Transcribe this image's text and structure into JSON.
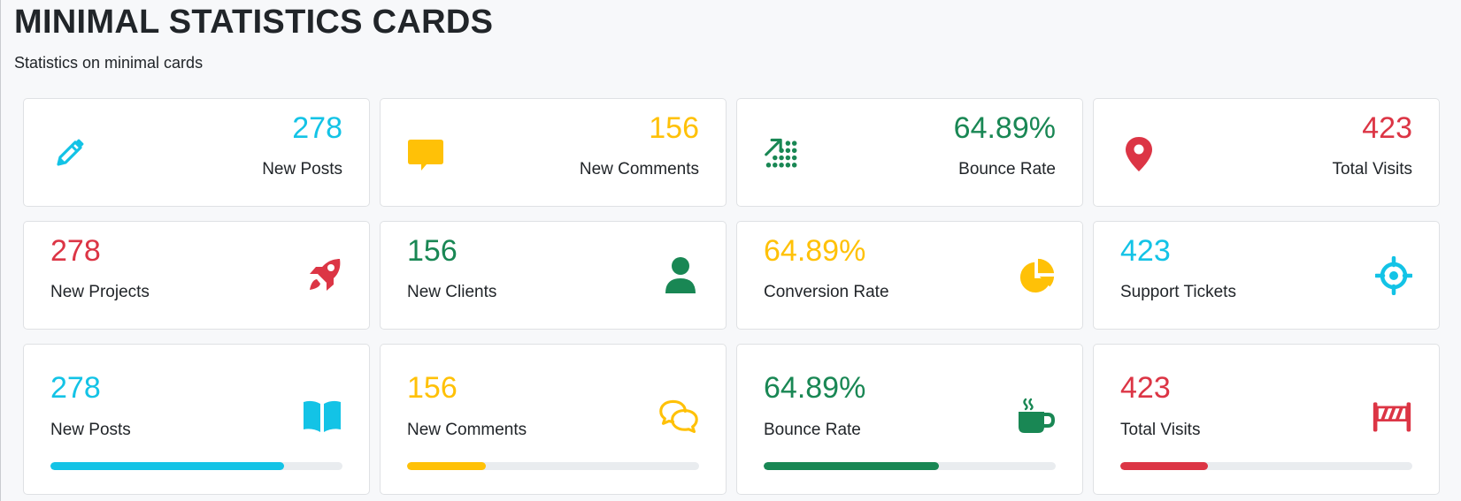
{
  "header": {
    "title": "MINIMAL STATISTICS CARDS",
    "subtitle": "Statistics on minimal cards"
  },
  "colors": {
    "info": "#13c3e6",
    "warning": "#ffc107",
    "success": "#198754",
    "danger": "#dc3545"
  },
  "row1": [
    {
      "value": "278",
      "label": "New Posts",
      "color": "#13c3e6",
      "icon": "pencil-icon"
    },
    {
      "value": "156",
      "label": "New Comments",
      "color": "#ffc107",
      "icon": "speech-bubble-icon"
    },
    {
      "value": "64.89%",
      "label": "Bounce Rate",
      "color": "#198754",
      "icon": "trend-up-dots-icon"
    },
    {
      "value": "423",
      "label": "Total Visits",
      "color": "#dc3545",
      "icon": "map-pin-icon"
    }
  ],
  "row2": [
    {
      "value": "278",
      "label": "New Projects",
      "color": "#dc3545",
      "icon": "rocket-icon"
    },
    {
      "value": "156",
      "label": "New Clients",
      "color": "#198754",
      "icon": "user-icon"
    },
    {
      "value": "64.89%",
      "label": "Conversion Rate",
      "color": "#ffc107",
      "icon": "pie-chart-icon"
    },
    {
      "value": "423",
      "label": "Support Tickets",
      "color": "#13c3e6",
      "icon": "crosshair-icon"
    }
  ],
  "row3": [
    {
      "value": "278",
      "label": "New Posts",
      "color": "#13c3e6",
      "icon": "book-open-icon",
      "progress": 0.8
    },
    {
      "value": "156",
      "label": "New Comments",
      "color": "#ffc107",
      "icon": "chat-bubbles-icon",
      "progress": 0.27
    },
    {
      "value": "64.89%",
      "label": "Bounce Rate",
      "color": "#198754",
      "icon": "coffee-cup-icon",
      "progress": 0.6
    },
    {
      "value": "423",
      "label": "Total Visits",
      "color": "#dc3545",
      "icon": "road-barrier-icon",
      "progress": 0.3
    }
  ]
}
